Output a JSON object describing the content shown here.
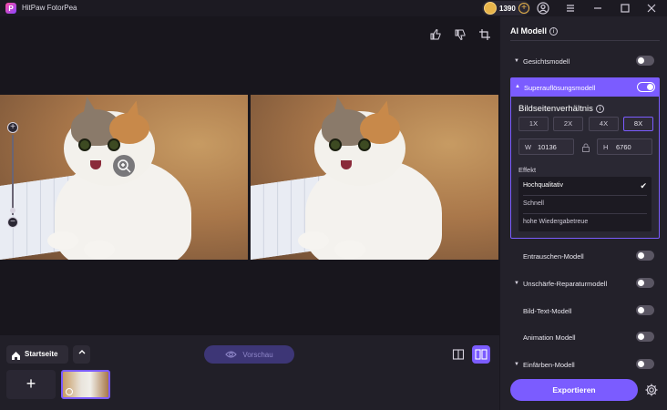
{
  "app": {
    "title": "HitPaw FotorPea",
    "logo_letter": "P",
    "credits": "1390"
  },
  "bottom": {
    "home_label": "Startseite",
    "preview_label": "Vorschau",
    "add_label": "+"
  },
  "sidebar": {
    "title": "AI Modell",
    "models": [
      {
        "label": "Gesichtsmodell",
        "enabled": false,
        "expandable": true
      },
      {
        "label": "Superauflösungsmodell",
        "enabled": true,
        "expandable": true
      },
      {
        "label": "Entrauschen-Modell",
        "enabled": false,
        "expandable": false
      },
      {
        "label": "Unschärfe-Reparaturmodell",
        "enabled": false,
        "expandable": true
      },
      {
        "label": "Bild-Text-Modell",
        "enabled": false,
        "expandable": false
      },
      {
        "label": "Animation Modell",
        "enabled": false,
        "expandable": false
      },
      {
        "label": "Einfärben-Modell",
        "enabled": false,
        "expandable": true
      }
    ],
    "superres": {
      "aspect_label": "Bildseitenverhältnis",
      "scales": [
        "1X",
        "2X",
        "4X",
        "8X"
      ],
      "active_scale": "8X",
      "width_key": "W",
      "width_value": "10136",
      "height_key": "H",
      "height_value": "6760",
      "effect_label": "Effekt",
      "effects": [
        "Hochqualitativ",
        "Schnell",
        "hohe Wiedergabetreue"
      ],
      "selected_effect": "Hochqualitativ"
    },
    "export_label": "Exportieren"
  },
  "colors": {
    "accent": "#7b5cff",
    "background": "#19171f",
    "sidebar": "#23212a"
  }
}
